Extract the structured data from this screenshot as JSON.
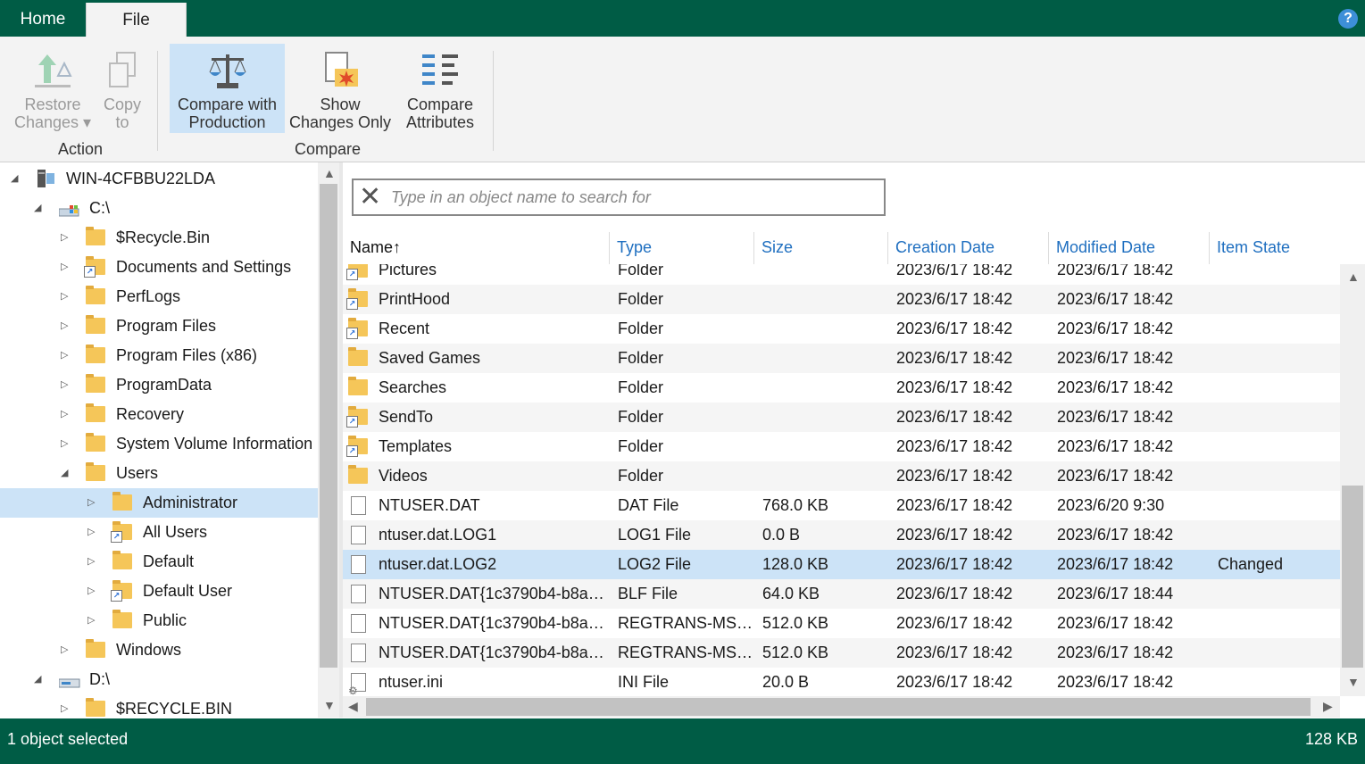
{
  "tabs": {
    "home": "Home",
    "file": "File"
  },
  "help_label": "?",
  "ribbon": {
    "restore": {
      "line1": "Restore",
      "line2": "Changes ▾"
    },
    "copy": {
      "line1": "Copy",
      "line2": "to"
    },
    "compare_prod": {
      "line1": "Compare with",
      "line2": "Production"
    },
    "show_changes": {
      "line1": "Show",
      "line2": "Changes Only"
    },
    "compare_attr": {
      "line1": "Compare",
      "line2": "Attributes"
    },
    "group_action": "Action",
    "group_compare": "Compare"
  },
  "tree": [
    {
      "label": "WIN-4CFBBU22LDA",
      "depth": 0,
      "expander": "open",
      "icon": "computer"
    },
    {
      "label": "C:\\",
      "depth": 1,
      "expander": "open",
      "icon": "drive-windows"
    },
    {
      "label": "$Recycle.Bin",
      "depth": 2,
      "expander": "closed",
      "icon": "folder"
    },
    {
      "label": "Documents and Settings",
      "depth": 2,
      "expander": "closed",
      "icon": "folder-shortcut"
    },
    {
      "label": "PerfLogs",
      "depth": 2,
      "expander": "closed",
      "icon": "folder"
    },
    {
      "label": "Program Files",
      "depth": 2,
      "expander": "closed",
      "icon": "folder"
    },
    {
      "label": "Program Files (x86)",
      "depth": 2,
      "expander": "closed",
      "icon": "folder"
    },
    {
      "label": "ProgramData",
      "depth": 2,
      "expander": "closed",
      "icon": "folder"
    },
    {
      "label": "Recovery",
      "depth": 2,
      "expander": "closed",
      "icon": "folder"
    },
    {
      "label": "System Volume Information",
      "depth": 2,
      "expander": "closed",
      "icon": "folder"
    },
    {
      "label": "Users",
      "depth": 2,
      "expander": "open",
      "icon": "folder"
    },
    {
      "label": "Administrator",
      "depth": 3,
      "expander": "closed",
      "icon": "folder",
      "selected": true
    },
    {
      "label": "All Users",
      "depth": 3,
      "expander": "closed",
      "icon": "folder-shortcut"
    },
    {
      "label": "Default",
      "depth": 3,
      "expander": "closed",
      "icon": "folder"
    },
    {
      "label": "Default User",
      "depth": 3,
      "expander": "closed",
      "icon": "folder-shortcut"
    },
    {
      "label": "Public",
      "depth": 3,
      "expander": "closed",
      "icon": "folder"
    },
    {
      "label": "Windows",
      "depth": 2,
      "expander": "closed",
      "icon": "folder"
    },
    {
      "label": "D:\\",
      "depth": 1,
      "expander": "open",
      "icon": "drive"
    },
    {
      "label": "$RECYCLE.BIN",
      "depth": 2,
      "expander": "closed",
      "icon": "folder"
    }
  ],
  "search": {
    "placeholder": "Type in an object name to search for"
  },
  "columns": {
    "name": "Name↑",
    "type": "Type",
    "size": "Size",
    "created": "Creation Date",
    "modified": "Modified Date",
    "state": "Item State"
  },
  "rows": [
    {
      "name": "Pictures",
      "icon": "folder-shortcut",
      "type": "Folder",
      "size": "",
      "created": "2023/6/17 18:42",
      "modified": "2023/6/17 18:42",
      "state": ""
    },
    {
      "name": "PrintHood",
      "icon": "folder-shortcut",
      "type": "Folder",
      "size": "",
      "created": "2023/6/17 18:42",
      "modified": "2023/6/17 18:42",
      "state": ""
    },
    {
      "name": "Recent",
      "icon": "folder-shortcut",
      "type": "Folder",
      "size": "",
      "created": "2023/6/17 18:42",
      "modified": "2023/6/17 18:42",
      "state": ""
    },
    {
      "name": "Saved Games",
      "icon": "folder",
      "type": "Folder",
      "size": "",
      "created": "2023/6/17 18:42",
      "modified": "2023/6/17 18:42",
      "state": ""
    },
    {
      "name": "Searches",
      "icon": "folder",
      "type": "Folder",
      "size": "",
      "created": "2023/6/17 18:42",
      "modified": "2023/6/17 18:42",
      "state": ""
    },
    {
      "name": "SendTo",
      "icon": "folder-shortcut",
      "type": "Folder",
      "size": "",
      "created": "2023/6/17 18:42",
      "modified": "2023/6/17 18:42",
      "state": ""
    },
    {
      "name": "Templates",
      "icon": "folder-shortcut",
      "type": "Folder",
      "size": "",
      "created": "2023/6/17 18:42",
      "modified": "2023/6/17 18:42",
      "state": ""
    },
    {
      "name": "Videos",
      "icon": "folder",
      "type": "Folder",
      "size": "",
      "created": "2023/6/17 18:42",
      "modified": "2023/6/17 18:42",
      "state": ""
    },
    {
      "name": "NTUSER.DAT",
      "icon": "file",
      "type": "DAT File",
      "size": "768.0 KB",
      "created": "2023/6/17 18:42",
      "modified": "2023/6/20 9:30",
      "state": ""
    },
    {
      "name": "ntuser.dat.LOG1",
      "icon": "file",
      "type": "LOG1 File",
      "size": "0.0 B",
      "created": "2023/6/17 18:42",
      "modified": "2023/6/17 18:42",
      "state": ""
    },
    {
      "name": "ntuser.dat.LOG2",
      "icon": "file",
      "type": "LOG2 File",
      "size": "128.0 KB",
      "created": "2023/6/17 18:42",
      "modified": "2023/6/17 18:42",
      "state": "Changed",
      "selected": true
    },
    {
      "name": "NTUSER.DAT{1c3790b4-b8ad-...",
      "icon": "file",
      "type": "BLF File",
      "size": "64.0 KB",
      "created": "2023/6/17 18:42",
      "modified": "2023/6/17 18:44",
      "state": ""
    },
    {
      "name": "NTUSER.DAT{1c3790b4-b8ad-...",
      "icon": "file",
      "type": "REGTRANS-MS File",
      "size": "512.0 KB",
      "created": "2023/6/17 18:42",
      "modified": "2023/6/17 18:42",
      "state": ""
    },
    {
      "name": "NTUSER.DAT{1c3790b4-b8ad-...",
      "icon": "file",
      "type": "REGTRANS-MS File",
      "size": "512.0 KB",
      "created": "2023/6/17 18:42",
      "modified": "2023/6/17 18:42",
      "state": ""
    },
    {
      "name": "ntuser.ini",
      "icon": "file-settings",
      "type": "INI File",
      "size": "20.0 B",
      "created": "2023/6/17 18:42",
      "modified": "2023/6/17 18:42",
      "state": ""
    }
  ],
  "status": {
    "left": "1 object selected",
    "right": "128 KB"
  },
  "colors": {
    "brand": "#005c45",
    "selection": "#cce3f7",
    "link": "#1f6fc0"
  }
}
